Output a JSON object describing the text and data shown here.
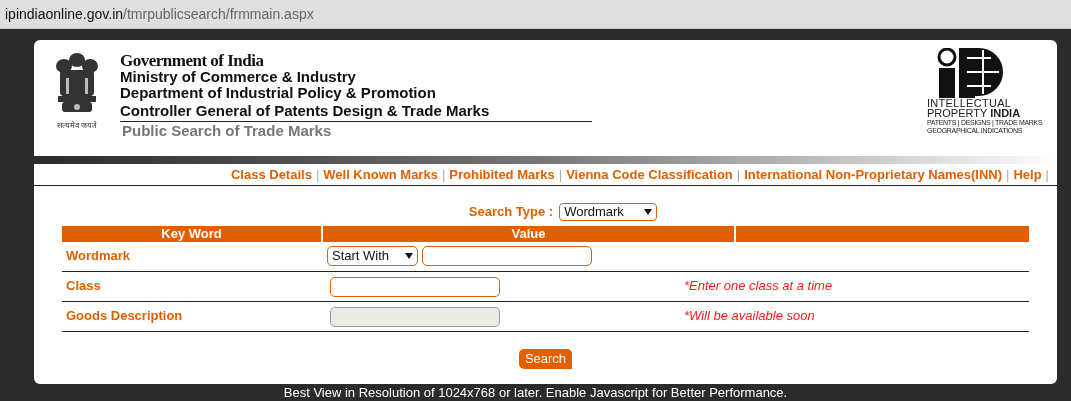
{
  "address_bar": {
    "url_host": "ipindiaonline.gov.in",
    "url_path": "/tmrpublicsearch/frmmain.aspx"
  },
  "header": {
    "emblem_motto": "सत्यमेव जयते",
    "lines": [
      "Government of India",
      "Ministry of Commerce & Industry",
      "Department of Industrial Policy & Promotion",
      "Controller General of Patents Design & Trade Marks"
    ],
    "subtitle": "Public Search of Trade Marks",
    "ip_logo": {
      "line_1": "INTELLECTUAL",
      "line_2": "PROPERTY **INDIA**",
      "line_3": "PATENTS | DESIGNS | TRADE MARKS",
      "line_4": "GEOGRAPHICAL INDICATIONS"
    }
  },
  "nav_links": [
    {
      "label": "Class Details",
      "separator": "|"
    },
    {
      "label": "Well Known Marks",
      "separator": "|"
    },
    {
      "label": "Prohibited Marks",
      "separator": "|"
    },
    {
      "label": "Vienna Code Classification",
      "separator": "|"
    },
    {
      "label": "International Non-Proprietary Names(INN)",
      "separator": "|"
    },
    {
      "label": "Help",
      "separator": "|"
    }
  ],
  "search_type": {
    "label": "Search Type :",
    "value": "Wordmark"
  },
  "table": {
    "columns": [
      "Key Word",
      "Value"
    ],
    "rows": [
      {
        "label": "Wordmark",
        "kind": "select_text",
        "select_value": "Start With",
        "disabled": false
      },
      {
        "label": "Class",
        "kind": "text",
        "note": "*Enter one class at a time",
        "disabled": false
      },
      {
        "label": "Goods Description",
        "kind": "text",
        "note": "*Will be available soon",
        "disabled": true
      }
    ]
  },
  "search_button": "Search",
  "footer": "Best View in Resolution of 1024x768 or later. Enable Javascript for Better Performance."
}
